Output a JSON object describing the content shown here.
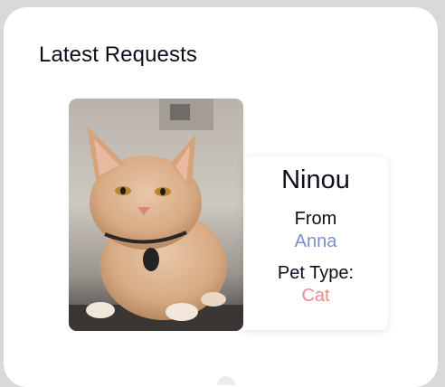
{
  "section": {
    "title": "Latest Requests"
  },
  "request": {
    "pet_name": "Ninou",
    "from_label": "From",
    "owner_name": "Anna",
    "type_label": "Pet Type:",
    "pet_type": "Cat"
  },
  "colors": {
    "owner_accent": "#7d8ecf",
    "type_accent": "#ef8a8a",
    "text_primary": "#0c0d1c"
  }
}
